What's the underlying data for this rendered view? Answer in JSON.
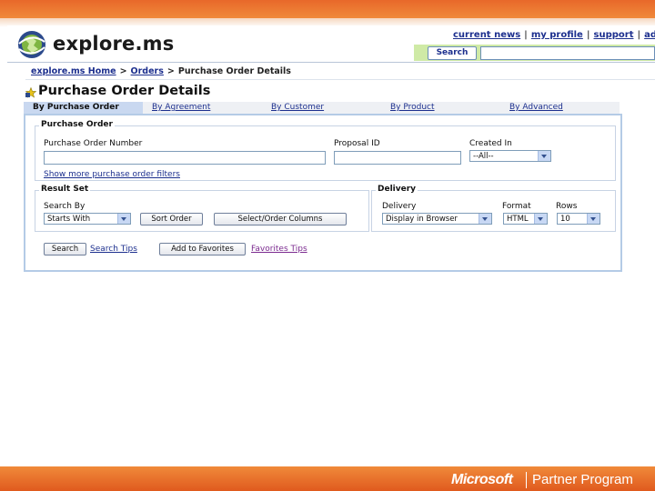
{
  "header": {
    "logo_text": "explore.ms",
    "nav": [
      "current news",
      "my profile",
      "support",
      "ad"
    ],
    "search_button": "Search"
  },
  "breadcrumb": [
    "explore.ms Home",
    "Orders",
    "Purchase Order Details"
  ],
  "page_title": "Purchase Order Details",
  "tabs": [
    "By Purchase Order",
    "By Agreement",
    "By Customer",
    "By Product",
    "By Advanced"
  ],
  "purchase_order": {
    "legend": "Purchase Order",
    "po_number_label": "Purchase Order Number",
    "proposal_label": "Proposal ID",
    "created_label": "Created In",
    "created_value": "--All--",
    "more_filters": "Show more purchase order filters"
  },
  "result_set": {
    "legend": "Result Set",
    "search_by_label": "Search By",
    "search_by_value": "Starts With",
    "sort_button": "Sort Order",
    "columns_button": "Select/Order Columns"
  },
  "delivery": {
    "legend": "Delivery",
    "delivery_label": "Delivery",
    "delivery_value": "Display in Browser",
    "format_label": "Format",
    "format_value": "HTML",
    "rows_label": "Rows",
    "rows_value": "10"
  },
  "actions": {
    "search_button": "Search",
    "search_tips": "Search Tips",
    "favorites_button": "Add to Favorites",
    "favorites_tips": "Favorites Tips"
  },
  "footer": {
    "brand": "Microsoft",
    "program": "Partner Program"
  },
  "colors": {
    "brand_orange": "#e8682a",
    "link_blue": "#1c2f8e",
    "panel_border": "#b4cbe6",
    "search_band": "#cfeaa6"
  }
}
